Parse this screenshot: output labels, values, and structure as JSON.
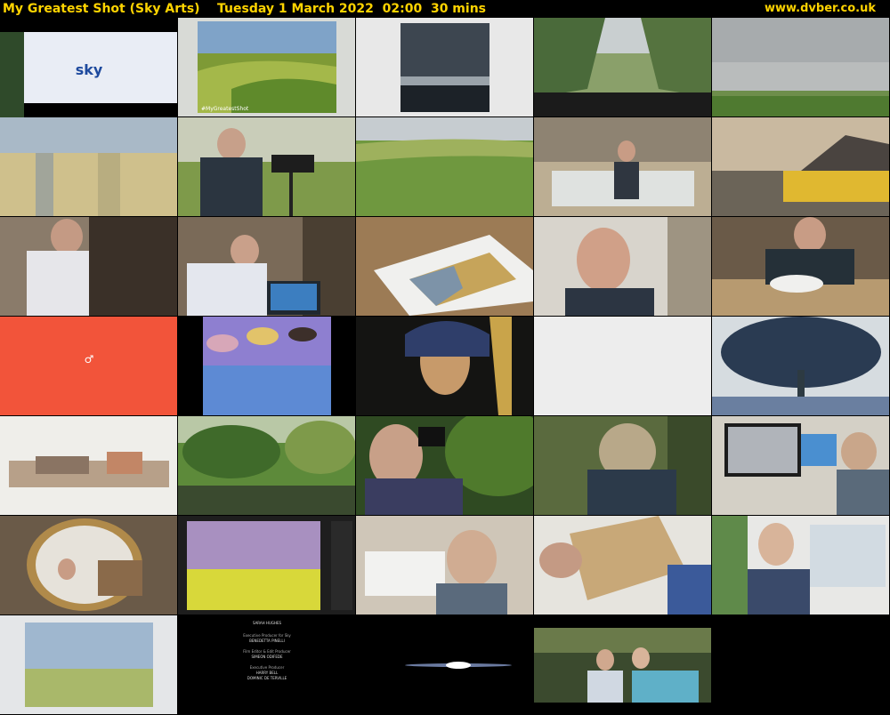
{
  "header": {
    "title": "My Greatest Shot (Sky Arts)    Tuesday 1 March 2022  02:00  30 mins",
    "site": "www.dvber.co.uk"
  },
  "thumbnails": {
    "sky_logo": "sky",
    "watermark": "#MyGreatestShot",
    "female_symbol": "♂",
    "credits": [
      "SARAH HUGHES",
      "Executive Producer for Sky",
      "BENEDETTA PINELLI",
      "Film Editor & Edit Producer",
      "SIMEON ODIFEDE",
      "Executive Producer",
      "HARRY BELL",
      "DOMINIC DE TERVILLE"
    ]
  },
  "colors": {
    "accent": "#ffd400",
    "background": "#000000"
  }
}
